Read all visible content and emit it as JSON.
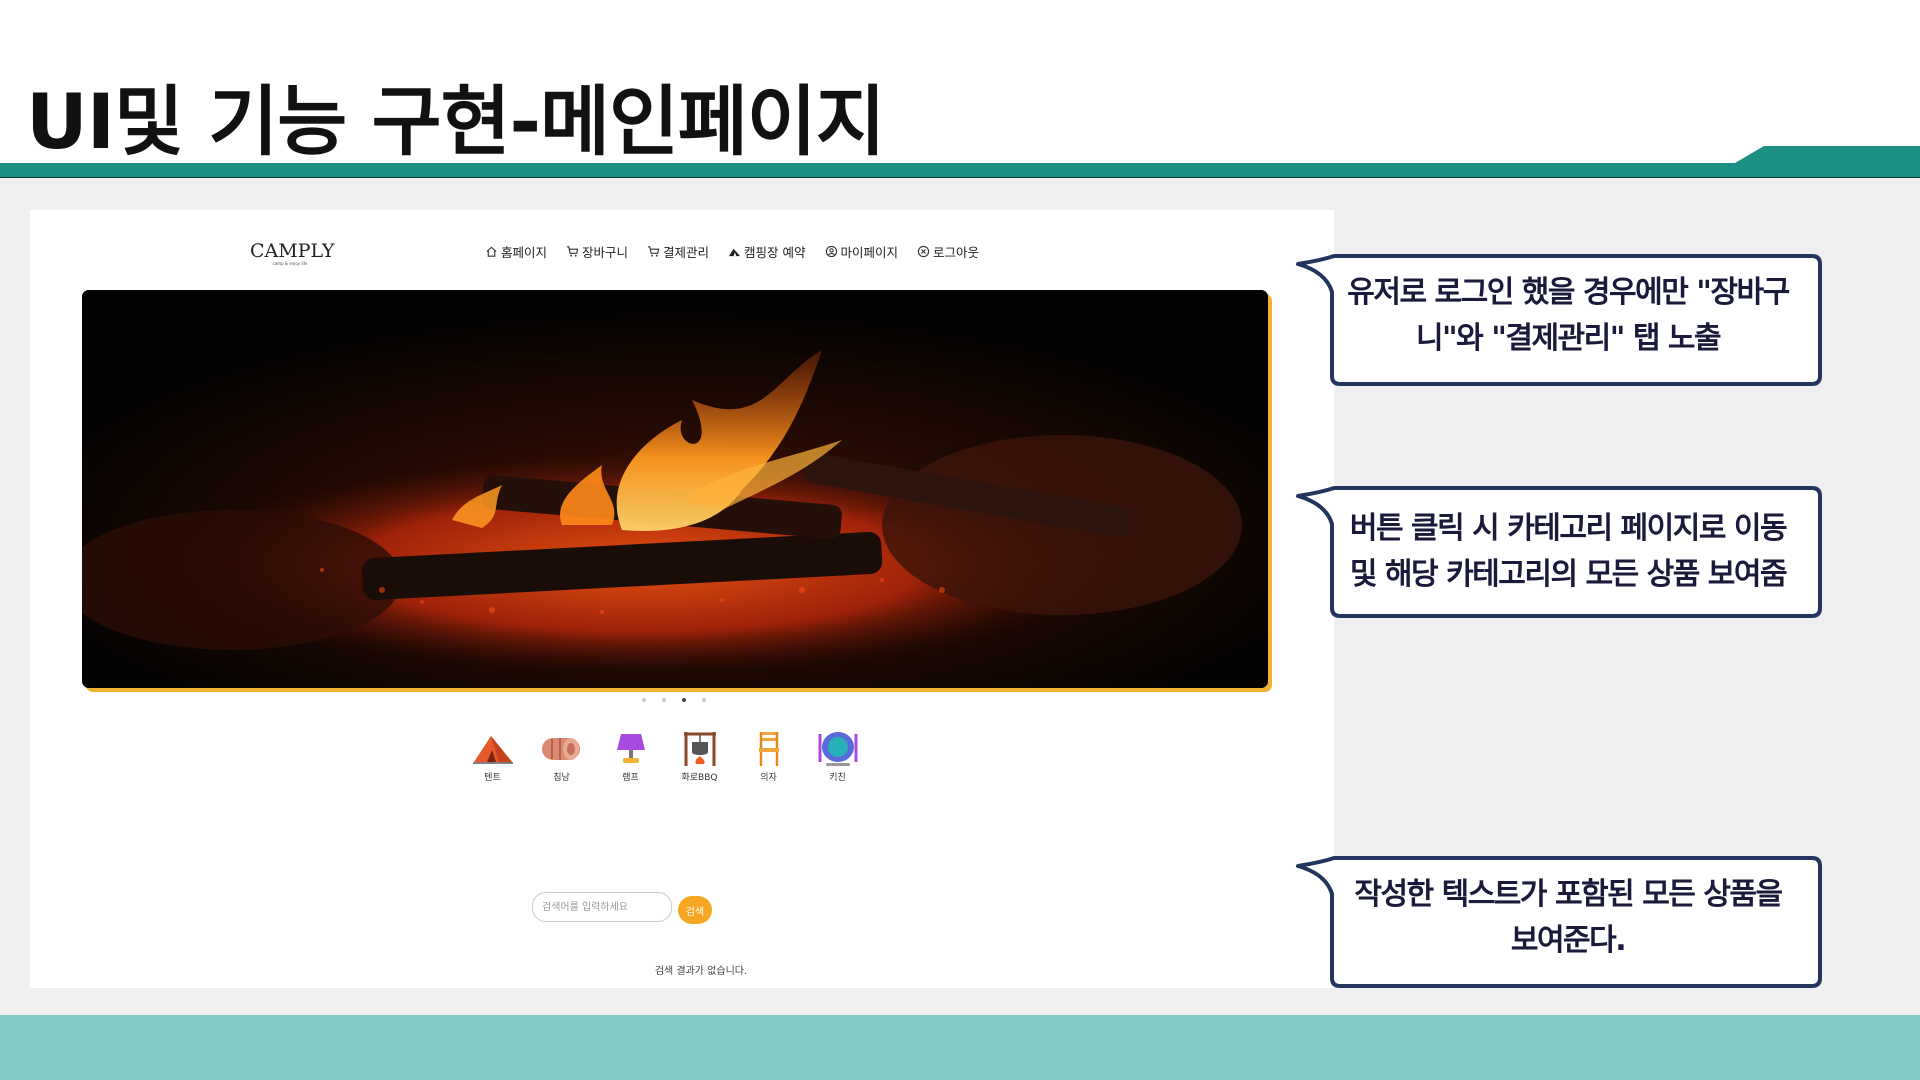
{
  "slide": {
    "title": "UI및 기능 구현-메인페이지",
    "colors": {
      "accent_bar": "#1c9082",
      "bottom_band": "#82cbc3",
      "callout_border": "#23355e"
    }
  },
  "app": {
    "brand": {
      "name": "CAMPLY",
      "tagline": "camp & enjoy life"
    },
    "nav": [
      {
        "label": "홈페이지",
        "icon": "home-icon"
      },
      {
        "label": "장바구니",
        "icon": "cart-icon"
      },
      {
        "label": "결제관리",
        "icon": "cart-icon"
      },
      {
        "label": "캠핑장 예약",
        "icon": "tent-icon"
      },
      {
        "label": "마이페이지",
        "icon": "user-circle-icon"
      },
      {
        "label": "로그아웃",
        "icon": "close-circle-icon"
      }
    ],
    "hero": {
      "description": "campfire",
      "active_slide": 3,
      "slide_count": 4
    },
    "categories": [
      {
        "label": "텐트",
        "icon": "tent-icon"
      },
      {
        "label": "침낭",
        "icon": "sleeping-bag-icon"
      },
      {
        "label": "램프",
        "icon": "lamp-icon"
      },
      {
        "label": "화로BBQ",
        "icon": "bbq-icon"
      },
      {
        "label": "의자",
        "icon": "chair-icon"
      },
      {
        "label": "키친",
        "icon": "kitchen-icon"
      }
    ],
    "search": {
      "placeholder": "검색어를 입력하세요",
      "button_label": "검색",
      "result_text": "검색 결과가 없습니다."
    },
    "colors": {
      "accent": "#f6a623"
    }
  },
  "callouts": [
    {
      "lines": [
        "유저로 로그인 했을 경우에만 \"장바구",
        "니\"와 \"결제관리\" 탭 노출"
      ]
    },
    {
      "lines": [
        "버튼 클릭 시 카테고리 페이지로 이동",
        "및 해당 카테고리의 모든 상품 보여줌"
      ]
    },
    {
      "lines": [
        "작성한 텍스트가 포함된 모든 상품을",
        "보여준다."
      ]
    }
  ]
}
